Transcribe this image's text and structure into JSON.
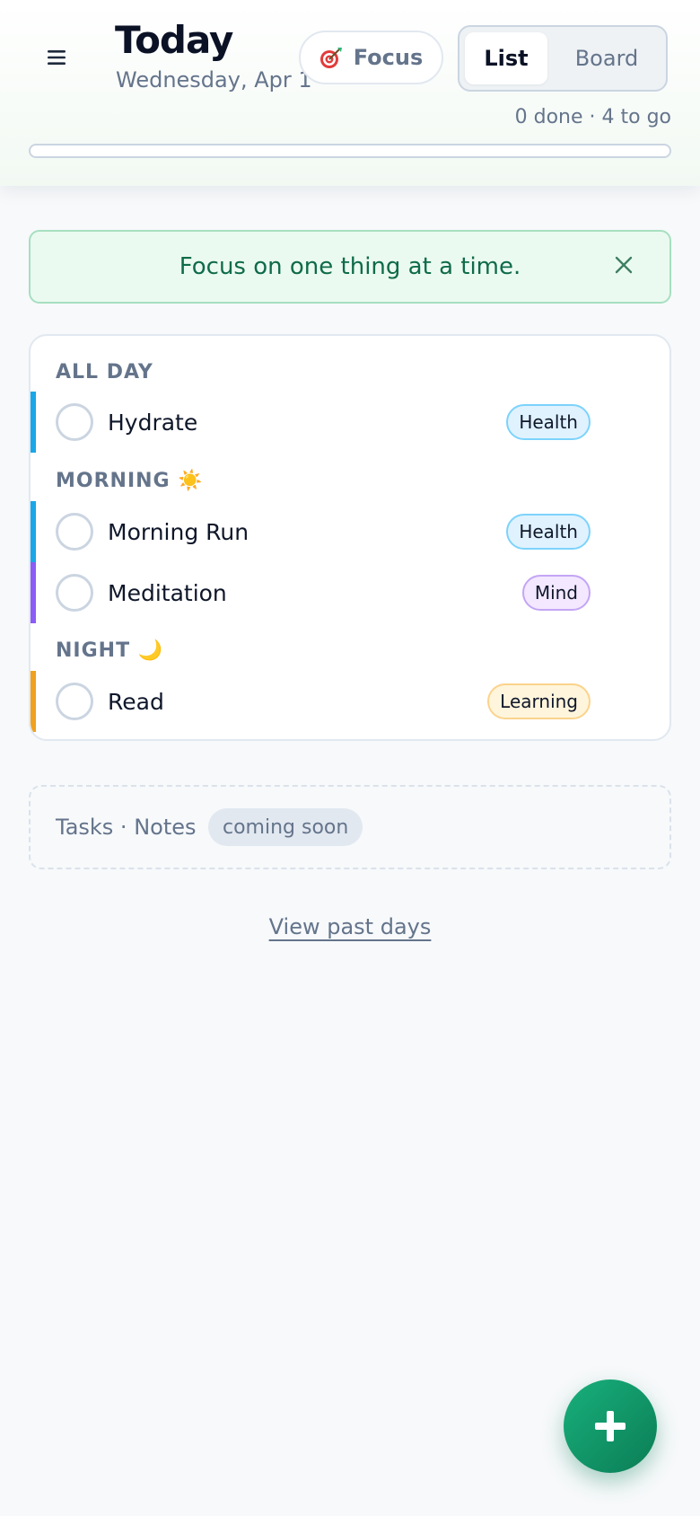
{
  "header": {
    "menu_icon": "hamburger-menu-icon",
    "title": "Today",
    "date": "Wednesday, Apr 1",
    "focus_label": "Focus",
    "focus_icon": "dart-target-icon",
    "view_toggle": {
      "list_label": "List",
      "board_label": "Board",
      "selected": "List"
    },
    "progress_text": "0 done · 4 to go",
    "progress_fraction": 0
  },
  "banner": {
    "text": "Focus on one thing at a time.",
    "close_icon": "close-icon"
  },
  "sections": [
    {
      "label": "ALL DAY",
      "icon": ""
    },
    {
      "label": "MORNING ☀️",
      "icon": "sun-icon"
    },
    {
      "label": "NIGHT 🌙",
      "icon": "moon-icon"
    }
  ],
  "habits": [
    {
      "name": "Hydrate",
      "tag": "Health",
      "accent": "#1aa7e8",
      "done": false
    },
    {
      "name": "Morning Run",
      "tag": "Health",
      "accent": "#1aa7e8",
      "done": false
    },
    {
      "name": "Meditation",
      "tag": "Mind",
      "accent": "#8b5cf6",
      "done": false
    },
    {
      "name": "Read",
      "tag": "Learning",
      "accent": "#f0a11f",
      "done": false
    }
  ],
  "footer": {
    "tabs_text": "Tasks · Notes",
    "coming_soon": "coming soon",
    "past_link": "View past days"
  },
  "fab": {
    "icon": "plus-icon"
  },
  "colors": {
    "accent_green": "#10a36e",
    "health": "#1aa7e8",
    "mind": "#8b5cf6",
    "learning": "#f0a11f"
  }
}
